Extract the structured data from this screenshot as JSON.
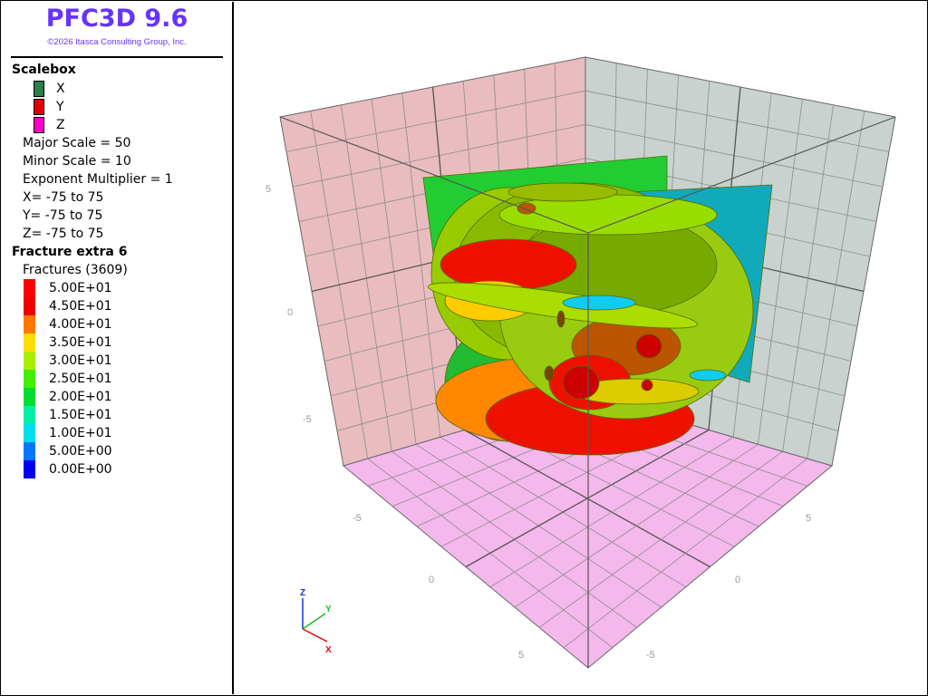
{
  "app": {
    "title": "PFC3D 9.6",
    "copyright": "©2026 Itasca Consulting Group, Inc."
  },
  "scalebox": {
    "heading": "Scalebox",
    "axes": [
      {
        "label": "X",
        "color": "#2e7d4a"
      },
      {
        "label": "Y",
        "color": "#e00000"
      },
      {
        "label": "Z",
        "color": "#ff00cc"
      }
    ],
    "lines": [
      "Major Scale = 50",
      "Minor Scale = 10",
      "Exponent Multiplier = 1",
      "X= -75 to 75",
      "Y= -75 to 75",
      "Z= -75 to 75"
    ]
  },
  "fracture": {
    "heading": "Fracture extra 6",
    "subheading": "Fractures (3609)",
    "scale": [
      {
        "label": "5.00E+01",
        "color": "#ff0000"
      },
      {
        "label": "4.50E+01",
        "color": "#ee0000"
      },
      {
        "label": "4.00E+01",
        "color": "#ff7700"
      },
      {
        "label": "3.50E+01",
        "color": "#ffdd00"
      },
      {
        "label": "3.00E+01",
        "color": "#aaee00"
      },
      {
        "label": "2.50E+01",
        "color": "#44ee00"
      },
      {
        "label": "2.00E+01",
        "color": "#00dd33"
      },
      {
        "label": "1.50E+01",
        "color": "#00eeaa"
      },
      {
        "label": "1.00E+01",
        "color": "#00ddee"
      },
      {
        "label": "5.00E+00",
        "color": "#0077ff"
      },
      {
        "label": "0.00E+00",
        "color": "#0000ee"
      }
    ]
  },
  "viewport": {
    "ticks": {
      "z_pos": "5",
      "z_zero": "0",
      "z_neg": "-5",
      "x_neg": "-5",
      "x_zero": "0",
      "x_pos": "5",
      "y_pos": "5",
      "y_zero": "0",
      "y_neg": "-5"
    },
    "triad": {
      "x": "X",
      "y": "Y",
      "z": "Z"
    },
    "colors": {
      "left_wall": "#e9bcbf",
      "right_wall": "#c9d2cf",
      "floor": "#f4b8ec",
      "grid": "#8c8c8c",
      "major_grid": "#555555"
    }
  }
}
